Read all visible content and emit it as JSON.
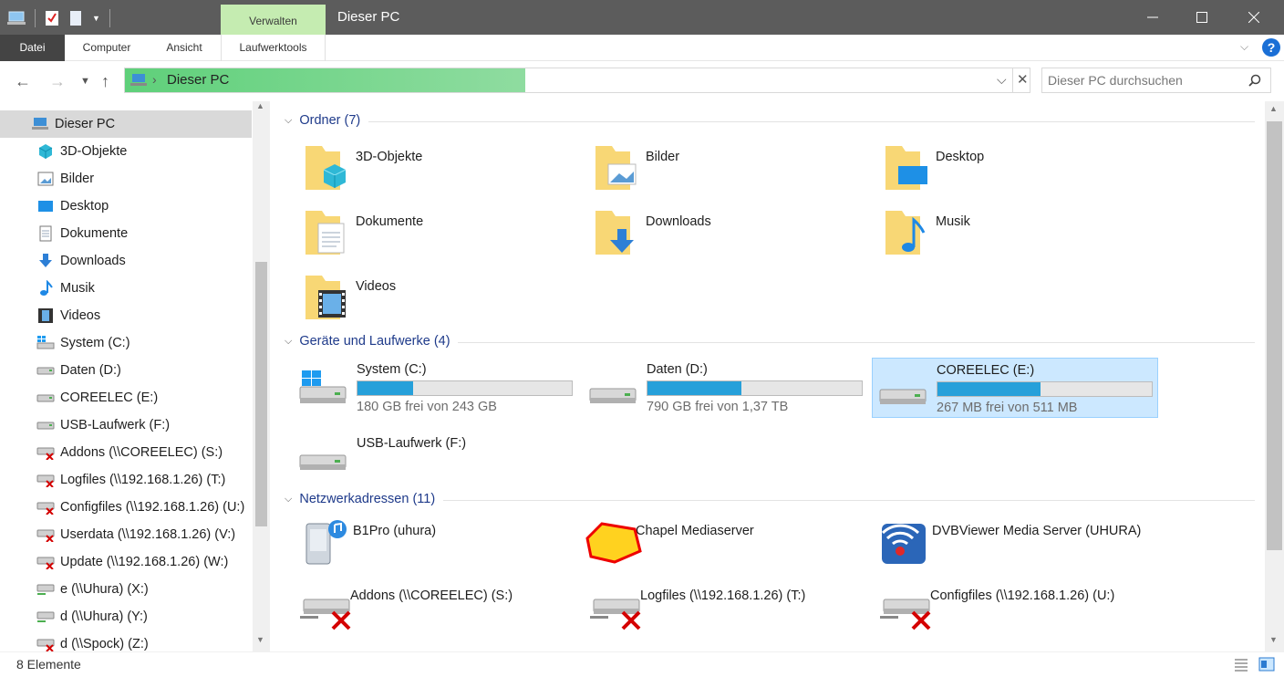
{
  "window": {
    "title": "Dieser PC",
    "tool_tab": "Verwalten"
  },
  "ribbon": {
    "tabs": [
      "Datei",
      "Computer",
      "Ansicht",
      "Laufwerktools"
    ]
  },
  "address": {
    "path": "Dieser PC"
  },
  "search": {
    "placeholder": "Dieser PC durchsuchen"
  },
  "sidebar": {
    "items": [
      {
        "label": "Dieser PC",
        "icon": "pc-icon"
      },
      {
        "label": "3D-Objekte",
        "icon": "cube-icon"
      },
      {
        "label": "Bilder",
        "icon": "picture-icon"
      },
      {
        "label": "Desktop",
        "icon": "desktop-icon"
      },
      {
        "label": "Dokumente",
        "icon": "document-icon"
      },
      {
        "label": "Downloads",
        "icon": "download-icon"
      },
      {
        "label": "Musik",
        "icon": "music-icon"
      },
      {
        "label": "Videos",
        "icon": "video-icon"
      },
      {
        "label": "System (C:)",
        "icon": "windows-drive-icon"
      },
      {
        "label": "Daten (D:)",
        "icon": "drive-icon"
      },
      {
        "label": "COREELEC (E:)",
        "icon": "drive-icon"
      },
      {
        "label": "USB-Laufwerk (F:)",
        "icon": "drive-icon"
      },
      {
        "label": "Addons (\\\\COREELEC) (S:)",
        "icon": "network-drive-error-icon"
      },
      {
        "label": "Logfiles (\\\\192.168.1.26) (T:)",
        "icon": "network-drive-error-icon"
      },
      {
        "label": "Configfiles (\\\\192.168.1.26) (U:)",
        "icon": "network-drive-error-icon"
      },
      {
        "label": "Userdata (\\\\192.168.1.26) (V:)",
        "icon": "network-drive-error-icon"
      },
      {
        "label": "Update (\\\\192.168.1.26) (W:)",
        "icon": "network-drive-error-icon"
      },
      {
        "label": "e (\\\\Uhura) (X:)",
        "icon": "network-drive-icon"
      },
      {
        "label": "d (\\\\Uhura) (Y:)",
        "icon": "network-drive-icon"
      },
      {
        "label": "d (\\\\Spock) (Z:)",
        "icon": "network-drive-error-icon"
      }
    ]
  },
  "sections": {
    "folders": "Ordner (7)",
    "drives": "Geräte und Laufwerke (4)",
    "network": "Netzwerkadressen (11)"
  },
  "folders": [
    "3D-Objekte",
    "Bilder",
    "Desktop",
    "Dokumente",
    "Downloads",
    "Musik",
    "Videos"
  ],
  "drives": [
    {
      "name": "System (C:)",
      "free": "180 GB frei von 243 GB",
      "used_fraction": 0.26
    },
    {
      "name": "Daten (D:)",
      "free": "790 GB frei von 1,37 TB",
      "used_fraction": 0.44
    },
    {
      "name": "COREELEC (E:)",
      "free": "267 MB frei von 511 MB",
      "used_fraction": 0.48
    },
    {
      "name": "USB-Laufwerk (F:)",
      "free": "",
      "used_fraction": null
    }
  ],
  "network": [
    "B1Pro (uhura)",
    "Chapel Mediaserver",
    "DVBViewer Media Server (UHURA)",
    "Addons (\\\\COREELEC) (S:)",
    "Logfiles (\\\\192.168.1.26) (T:)",
    "Configfiles (\\\\192.168.1.26) (U:)"
  ],
  "status": {
    "count": "8 Elemente"
  },
  "colors": {
    "accent": "#26a0da",
    "titlebar": "#5c5c5c",
    "tool_tab": "#c5ecb1",
    "selection": "#cce8ff"
  }
}
